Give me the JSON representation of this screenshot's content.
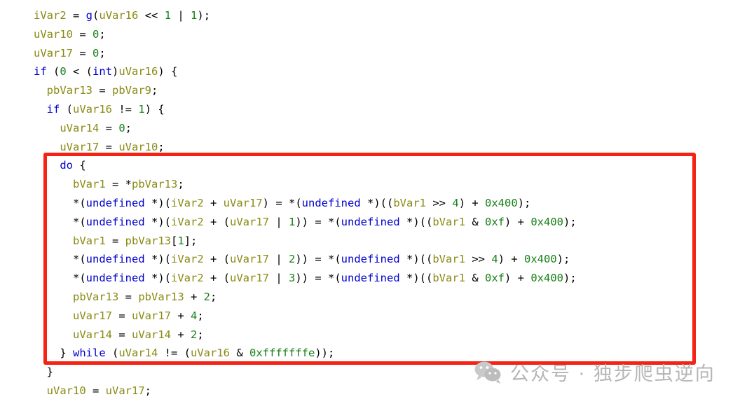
{
  "code": {
    "language": "c-decompiled",
    "font_size_px": 15.5,
    "indent_spaces": 2,
    "colors": {
      "background": "#ffffff",
      "plain": "#000000",
      "variable": "#8a8a14",
      "keyword": "#0000cd",
      "type": "#0000cd",
      "function": "#0000cd",
      "number": "#178117",
      "highlight_box": "#f42316"
    },
    "lines": [
      {
        "indent": 0,
        "partial": true,
        "text": "_                _",
        "tokens": [
          {
            "t": "    ",
            "c": "plain"
          },
          {
            "t": "_",
            "c": "type"
          },
          {
            "t": "                ",
            "c": "plain"
          },
          {
            "t": "_",
            "c": "type"
          }
        ]
      },
      {
        "indent": 0,
        "text": "iVar2 = g(uVar16 << 1 | 1);",
        "tokens": [
          {
            "t": "iVar2",
            "c": "variable"
          },
          {
            "t": " = ",
            "c": "plain"
          },
          {
            "t": "g",
            "c": "function"
          },
          {
            "t": "(",
            "c": "plain"
          },
          {
            "t": "uVar16",
            "c": "variable"
          },
          {
            "t": " << ",
            "c": "plain"
          },
          {
            "t": "1",
            "c": "number"
          },
          {
            "t": " | ",
            "c": "plain"
          },
          {
            "t": "1",
            "c": "number"
          },
          {
            "t": ");",
            "c": "plain"
          }
        ]
      },
      {
        "indent": 0,
        "text": "uVar10 = 0;",
        "tokens": [
          {
            "t": "uVar10",
            "c": "variable"
          },
          {
            "t": " = ",
            "c": "plain"
          },
          {
            "t": "0",
            "c": "number"
          },
          {
            "t": ";",
            "c": "plain"
          }
        ]
      },
      {
        "indent": 0,
        "text": "uVar17 = 0;",
        "tokens": [
          {
            "t": "uVar17",
            "c": "variable"
          },
          {
            "t": " = ",
            "c": "plain"
          },
          {
            "t": "0",
            "c": "number"
          },
          {
            "t": ";",
            "c": "plain"
          }
        ]
      },
      {
        "indent": 0,
        "text": "if (0 < (int)uVar16) {",
        "tokens": [
          {
            "t": "if",
            "c": "keyword"
          },
          {
            "t": " (",
            "c": "plain"
          },
          {
            "t": "0",
            "c": "number"
          },
          {
            "t": " < (",
            "c": "plain"
          },
          {
            "t": "int",
            "c": "type"
          },
          {
            "t": ")",
            "c": "plain"
          },
          {
            "t": "uVar16",
            "c": "variable"
          },
          {
            "t": ") {",
            "c": "plain"
          }
        ]
      },
      {
        "indent": 1,
        "text": "pbVar13 = pbVar9;",
        "tokens": [
          {
            "t": "pbVar13",
            "c": "variable"
          },
          {
            "t": " = ",
            "c": "plain"
          },
          {
            "t": "pbVar9",
            "c": "variable"
          },
          {
            "t": ";",
            "c": "plain"
          }
        ]
      },
      {
        "indent": 1,
        "text": "if (uVar16 != 1) {",
        "tokens": [
          {
            "t": "if",
            "c": "keyword"
          },
          {
            "t": " (",
            "c": "plain"
          },
          {
            "t": "uVar16",
            "c": "variable"
          },
          {
            "t": " != ",
            "c": "plain"
          },
          {
            "t": "1",
            "c": "number"
          },
          {
            "t": ") {",
            "c": "plain"
          }
        ]
      },
      {
        "indent": 2,
        "text": "uVar14 = 0;",
        "tokens": [
          {
            "t": "uVar14",
            "c": "variable"
          },
          {
            "t": " = ",
            "c": "plain"
          },
          {
            "t": "0",
            "c": "number"
          },
          {
            "t": ";",
            "c": "plain"
          }
        ]
      },
      {
        "indent": 2,
        "text": "uVar17 = uVar10;",
        "tokens": [
          {
            "t": "uVar17",
            "c": "variable"
          },
          {
            "t": " = ",
            "c": "plain"
          },
          {
            "t": "uVar10",
            "c": "variable"
          },
          {
            "t": ";",
            "c": "plain"
          }
        ]
      },
      {
        "indent": 2,
        "highlighted": true,
        "text": "do {",
        "tokens": [
          {
            "t": "do",
            "c": "keyword"
          },
          {
            "t": " {",
            "c": "plain"
          }
        ]
      },
      {
        "indent": 3,
        "highlighted": true,
        "text": "bVar1 = *pbVar13;",
        "tokens": [
          {
            "t": "bVar1",
            "c": "variable"
          },
          {
            "t": " = *",
            "c": "plain"
          },
          {
            "t": "pbVar13",
            "c": "variable"
          },
          {
            "t": ";",
            "c": "plain"
          }
        ]
      },
      {
        "indent": 3,
        "highlighted": true,
        "text": "*(undefined *)(iVar2 + uVar17) = *(undefined *)((bVar1 >> 4) + 0x400);",
        "tokens": [
          {
            "t": "*(",
            "c": "plain"
          },
          {
            "t": "undefined",
            "c": "type"
          },
          {
            "t": " *)(",
            "c": "plain"
          },
          {
            "t": "iVar2",
            "c": "variable"
          },
          {
            "t": " + ",
            "c": "plain"
          },
          {
            "t": "uVar17",
            "c": "variable"
          },
          {
            "t": ") = *(",
            "c": "plain"
          },
          {
            "t": "undefined",
            "c": "type"
          },
          {
            "t": " *)((",
            "c": "plain"
          },
          {
            "t": "bVar1",
            "c": "variable"
          },
          {
            "t": " >> ",
            "c": "plain"
          },
          {
            "t": "4",
            "c": "number"
          },
          {
            "t": ") + ",
            "c": "plain"
          },
          {
            "t": "0x400",
            "c": "number"
          },
          {
            "t": ");",
            "c": "plain"
          }
        ]
      },
      {
        "indent": 3,
        "highlighted": true,
        "text": "*(undefined *)(iVar2 + (uVar17 | 1)) = *(undefined *)((bVar1 & 0xf) + 0x400);",
        "tokens": [
          {
            "t": "*(",
            "c": "plain"
          },
          {
            "t": "undefined",
            "c": "type"
          },
          {
            "t": " *)(",
            "c": "plain"
          },
          {
            "t": "iVar2",
            "c": "variable"
          },
          {
            "t": " + (",
            "c": "plain"
          },
          {
            "t": "uVar17",
            "c": "variable"
          },
          {
            "t": " | ",
            "c": "plain"
          },
          {
            "t": "1",
            "c": "number"
          },
          {
            "t": ")) = *(",
            "c": "plain"
          },
          {
            "t": "undefined",
            "c": "type"
          },
          {
            "t": " *)((",
            "c": "plain"
          },
          {
            "t": "bVar1",
            "c": "variable"
          },
          {
            "t": " & ",
            "c": "plain"
          },
          {
            "t": "0xf",
            "c": "number"
          },
          {
            "t": ") + ",
            "c": "plain"
          },
          {
            "t": "0x400",
            "c": "number"
          },
          {
            "t": ");",
            "c": "plain"
          }
        ]
      },
      {
        "indent": 3,
        "highlighted": true,
        "text": "bVar1 = pbVar13[1];",
        "tokens": [
          {
            "t": "bVar1",
            "c": "variable"
          },
          {
            "t": " = ",
            "c": "plain"
          },
          {
            "t": "pbVar13",
            "c": "variable"
          },
          {
            "t": "[",
            "c": "plain"
          },
          {
            "t": "1",
            "c": "number"
          },
          {
            "t": "];",
            "c": "plain"
          }
        ]
      },
      {
        "indent": 3,
        "highlighted": true,
        "text": "*(undefined *)(iVar2 + (uVar17 | 2)) = *(undefined *)((bVar1 >> 4) + 0x400);",
        "tokens": [
          {
            "t": "*(",
            "c": "plain"
          },
          {
            "t": "undefined",
            "c": "type"
          },
          {
            "t": " *)(",
            "c": "plain"
          },
          {
            "t": "iVar2",
            "c": "variable"
          },
          {
            "t": " + (",
            "c": "plain"
          },
          {
            "t": "uVar17",
            "c": "variable"
          },
          {
            "t": " | ",
            "c": "plain"
          },
          {
            "t": "2",
            "c": "number"
          },
          {
            "t": ")) = *(",
            "c": "plain"
          },
          {
            "t": "undefined",
            "c": "type"
          },
          {
            "t": " *)((",
            "c": "plain"
          },
          {
            "t": "bVar1",
            "c": "variable"
          },
          {
            "t": " >> ",
            "c": "plain"
          },
          {
            "t": "4",
            "c": "number"
          },
          {
            "t": ") + ",
            "c": "plain"
          },
          {
            "t": "0x400",
            "c": "number"
          },
          {
            "t": ");",
            "c": "plain"
          }
        ]
      },
      {
        "indent": 3,
        "highlighted": true,
        "text": "*(undefined *)(iVar2 + (uVar17 | 3)) = *(undefined *)((bVar1 & 0xf) + 0x400);",
        "tokens": [
          {
            "t": "*(",
            "c": "plain"
          },
          {
            "t": "undefined",
            "c": "type"
          },
          {
            "t": " *)(",
            "c": "plain"
          },
          {
            "t": "iVar2",
            "c": "variable"
          },
          {
            "t": " + (",
            "c": "plain"
          },
          {
            "t": "uVar17",
            "c": "variable"
          },
          {
            "t": " | ",
            "c": "plain"
          },
          {
            "t": "3",
            "c": "number"
          },
          {
            "t": ")) = *(",
            "c": "plain"
          },
          {
            "t": "undefined",
            "c": "type"
          },
          {
            "t": " *)((",
            "c": "plain"
          },
          {
            "t": "bVar1",
            "c": "variable"
          },
          {
            "t": " & ",
            "c": "plain"
          },
          {
            "t": "0xf",
            "c": "number"
          },
          {
            "t": ") + ",
            "c": "plain"
          },
          {
            "t": "0x400",
            "c": "number"
          },
          {
            "t": ");",
            "c": "plain"
          }
        ]
      },
      {
        "indent": 3,
        "highlighted": true,
        "text": "pbVar13 = pbVar13 + 2;",
        "tokens": [
          {
            "t": "pbVar13",
            "c": "variable"
          },
          {
            "t": " = ",
            "c": "plain"
          },
          {
            "t": "pbVar13",
            "c": "variable"
          },
          {
            "t": " + ",
            "c": "plain"
          },
          {
            "t": "2",
            "c": "number"
          },
          {
            "t": ";",
            "c": "plain"
          }
        ]
      },
      {
        "indent": 3,
        "highlighted": true,
        "text": "uVar17 = uVar17 + 4;",
        "tokens": [
          {
            "t": "uVar17",
            "c": "variable"
          },
          {
            "t": " = ",
            "c": "plain"
          },
          {
            "t": "uVar17",
            "c": "variable"
          },
          {
            "t": " + ",
            "c": "plain"
          },
          {
            "t": "4",
            "c": "number"
          },
          {
            "t": ";",
            "c": "plain"
          }
        ]
      },
      {
        "indent": 3,
        "highlighted": true,
        "text": "uVar14 = uVar14 + 2;",
        "tokens": [
          {
            "t": "uVar14",
            "c": "variable"
          },
          {
            "t": " = ",
            "c": "plain"
          },
          {
            "t": "uVar14",
            "c": "variable"
          },
          {
            "t": " + ",
            "c": "plain"
          },
          {
            "t": "2",
            "c": "number"
          },
          {
            "t": ";",
            "c": "plain"
          }
        ]
      },
      {
        "indent": 2,
        "highlighted": true,
        "text": "} while (uVar14 != (uVar16 & 0xfffffffe));",
        "tokens": [
          {
            "t": "} ",
            "c": "plain"
          },
          {
            "t": "while",
            "c": "keyword"
          },
          {
            "t": " (",
            "c": "plain"
          },
          {
            "t": "uVar14",
            "c": "variable"
          },
          {
            "t": " != (",
            "c": "plain"
          },
          {
            "t": "uVar16",
            "c": "variable"
          },
          {
            "t": " & ",
            "c": "plain"
          },
          {
            "t": "0xfffffffe",
            "c": "number"
          },
          {
            "t": "));",
            "c": "plain"
          }
        ]
      },
      {
        "indent": 1,
        "text": "}",
        "tokens": [
          {
            "t": "}",
            "c": "plain"
          }
        ]
      },
      {
        "indent": 1,
        "text": "uVar10 = uVar17;",
        "tokens": [
          {
            "t": "uVar10",
            "c": "variable"
          },
          {
            "t": " = ",
            "c": "plain"
          },
          {
            "t": "uVar17",
            "c": "variable"
          },
          {
            "t": ";",
            "c": "plain"
          }
        ]
      }
    ]
  },
  "annotation": {
    "type": "rectangle-highlight",
    "color": "#f42316",
    "border_width_px": 5
  },
  "watermark": {
    "icon": "wechat-icon",
    "text": "公众号 · 独步爬虫逆向",
    "color": "#b6b6b6"
  }
}
